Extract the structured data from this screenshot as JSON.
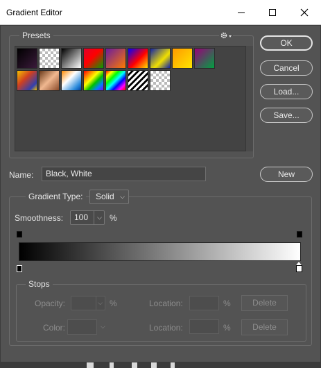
{
  "window": {
    "title": "Gradient Editor"
  },
  "presets": {
    "label": "Presets",
    "swatches": [
      {
        "css": "linear-gradient(135deg,#000 0%,#3a1a3a 100%)"
      },
      {
        "css": "repeating-conic-gradient(#bbb 0 25%, #fff 0 50%) 0 0/8px 8px"
      },
      {
        "css": "linear-gradient(135deg,#000 0%,#fff 100%)"
      },
      {
        "css": "linear-gradient(135deg,#e0002a 0%,#ff0000 45%,#00a000 100%)"
      },
      {
        "css": "linear-gradient(135deg,#6a1c9e 0%,#ff7a00 100%)"
      },
      {
        "css": "linear-gradient(135deg,#0000ff 0%,#ff0000 55%,#ffe000 100%)"
      },
      {
        "css": "linear-gradient(135deg,#1022a8 0%,#f0e000 60%,#1022a8 100%)"
      },
      {
        "css": "linear-gradient(135deg,#ff9a00 0%,#ffe400 100%)"
      },
      {
        "css": "linear-gradient(135deg,#9a007a 0%,#00a040 100%)"
      },
      {
        "css": "linear-gradient(135deg,#f4c000 0%,#d04020 40%,#3040b0 80%,#f4c000 100%)"
      },
      {
        "css": "linear-gradient(135deg,#6a3a1a 0%,#f0b890 50%,#8a4a2a 100%)"
      },
      {
        "css": "linear-gradient(135deg,#ff8a00 0%,#ffffff 40%,#2a8adc 80%,#0040a0 100%)"
      },
      {
        "css": "linear-gradient(135deg,#ff0000,#ff8000,#ffff00,#00c000,#0080ff,#8000ff)"
      },
      {
        "css": "linear-gradient(135deg,#ff0000,#ffff00,#00ff00,#00ffff,#0000ff,#ff00ff,#ff0000)"
      },
      {
        "css": "repeating-linear-gradient(135deg,#ffffff 0 3px,#000000 3px 6px)"
      },
      {
        "css": "repeating-conic-gradient(#bbb 0 25%, #fff 0 50%) 0 0/8px 8px"
      }
    ]
  },
  "buttons": {
    "ok": "OK",
    "cancel": "Cancel",
    "load": "Load...",
    "save": "Save...",
    "new": "New"
  },
  "name": {
    "label": "Name:",
    "value": "Black, White"
  },
  "gradient_type": {
    "label": "Gradient Type:",
    "value": "Solid"
  },
  "smoothness": {
    "label": "Smoothness:",
    "value": "100",
    "unit": "%"
  },
  "stops": {
    "label": "Stops",
    "opacity_label": "Opacity:",
    "opacity_unit": "%",
    "opacity_value": "",
    "color_label": "Color:",
    "location_label": "Location:",
    "location_unit": "%",
    "location_value": "",
    "delete_label": "Delete"
  },
  "colors": {
    "gradient_start": "#000000",
    "gradient_end": "#ffffff",
    "panel": "#535353"
  }
}
